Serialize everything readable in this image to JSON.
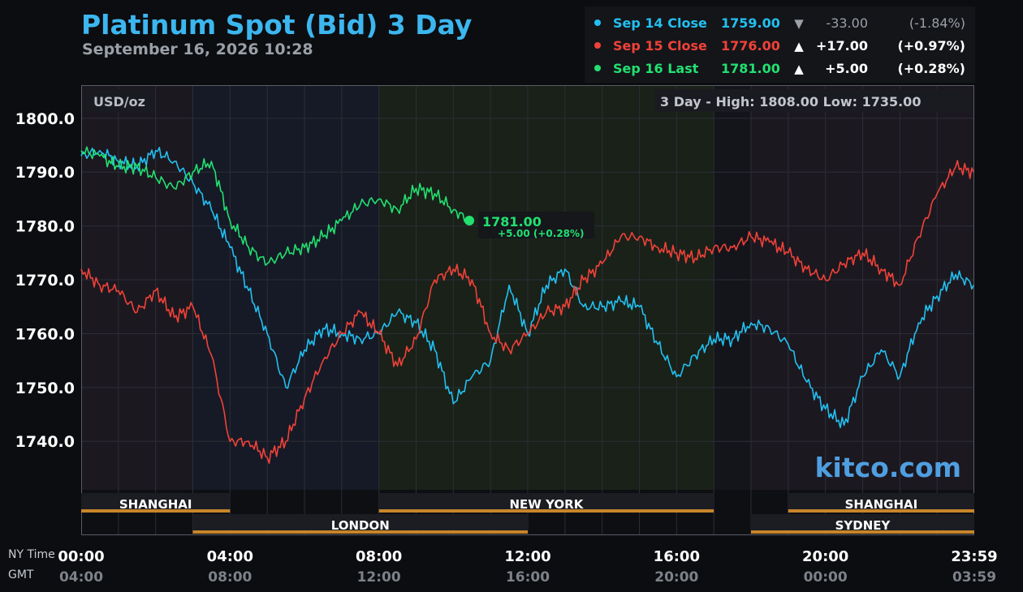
{
  "header": {
    "title": "Platinum Spot (Bid) 3 Day",
    "timestamp": "September 16, 2026 10:28"
  },
  "legend": [
    {
      "label": "Sep 14 Close",
      "price": "1759.00",
      "arrow": "▼",
      "change": "-33.00",
      "pct": "(-1.84%)",
      "color": "#22c0f0"
    },
    {
      "label": "Sep 15 Close",
      "price": "1776.00",
      "arrow": "▲",
      "change": "+17.00",
      "pct": "(+0.97%)",
      "color": "#f04238"
    },
    {
      "label": "Sep 16 Last",
      "price": "1781.00",
      "arrow": "▲",
      "change": "+5.00",
      "pct": "(+0.28%)",
      "color": "#22e070"
    }
  ],
  "chart": {
    "unit_label": "USD/oz",
    "range_label": "3 Day - High: 1808.00  Low: 1735.00",
    "watermark": "kitco.com",
    "last_price_label": "1781.00",
    "last_change_label": "+5.00 (+0.28%)",
    "ny_time_label": "NY Time",
    "gmt_label": "GMT",
    "grid": true
  },
  "sessions": [
    {
      "name": "SHANGHAI",
      "row": 1,
      "start": 0,
      "end": 4,
      "label_at": 2
    },
    {
      "name": "LONDON",
      "row": 2,
      "start": 3,
      "end": 12,
      "label_at": 7.5
    },
    {
      "name": "NEW YORK",
      "row": 1,
      "start": 8,
      "end": 17,
      "label_at": 12.5
    },
    {
      "name": "SHANGHAI",
      "row": 1,
      "start": 19,
      "end": 24,
      "label_at": 21.5
    },
    {
      "name": "SYDNEY",
      "row": 2,
      "start": 18,
      "end": 24,
      "label_at": 21
    }
  ],
  "chart_data": {
    "type": "line",
    "title": "Platinum Spot (Bid) 3 Day",
    "ylabel": "USD/oz",
    "ylim": [
      1731,
      1806
    ],
    "xlim": [
      0,
      24
    ],
    "yticks": [
      "1800.0",
      "1790.0",
      "1780.0",
      "1770.0",
      "1760.0",
      "1750.0",
      "1740.0"
    ],
    "ytick_values": [
      1800,
      1790,
      1780,
      1770,
      1760,
      1750,
      1740
    ],
    "xticks_ny": [
      "00:00",
      "04:00",
      "08:00",
      "12:00",
      "16:00",
      "20:00",
      "23:59"
    ],
    "xticks_gmt": [
      "04:00",
      "08:00",
      "12:00",
      "16:00",
      "20:00",
      "00:00",
      "03:59"
    ],
    "xtick_hours": [
      0,
      4,
      8,
      12,
      16,
      20,
      24
    ],
    "series": [
      {
        "name": "Sep 14 Close",
        "color": "#22c0f0",
        "x": [
          0,
          0.5,
          1,
          1.5,
          2,
          2.5,
          3,
          3.5,
          4,
          4.5,
          5,
          5.5,
          6,
          6.5,
          7,
          7.5,
          8,
          8.5,
          9,
          9.5,
          10,
          10.5,
          11,
          11.5,
          12,
          12.5,
          13,
          13.5,
          14,
          14.5,
          15,
          15.5,
          16,
          16.5,
          17,
          17.5,
          18,
          18.5,
          19,
          19.5,
          20,
          20.5,
          21,
          21.5,
          22,
          22.5,
          23,
          23.5,
          23.98
        ],
        "y": [
          1793,
          1794,
          1792,
          1791,
          1794,
          1792,
          1788,
          1783,
          1776,
          1768,
          1760,
          1750,
          1757,
          1761,
          1760,
          1759,
          1760,
          1764,
          1762,
          1757,
          1747,
          1752,
          1755,
          1769,
          1760,
          1769,
          1772,
          1765,
          1765,
          1766,
          1765,
          1758,
          1752,
          1756,
          1759,
          1759,
          1762,
          1761,
          1758,
          1751,
          1746,
          1743,
          1752,
          1757,
          1752,
          1762,
          1767,
          1771,
          1769
        ]
      },
      {
        "name": "Sep 15 Close",
        "color": "#f04238",
        "x": [
          0,
          0.5,
          1,
          1.5,
          2,
          2.5,
          3,
          3.5,
          4,
          4.5,
          5,
          5.5,
          6,
          6.5,
          7,
          7.5,
          8,
          8.5,
          9,
          9.5,
          10,
          10.5,
          11,
          11.5,
          12,
          12.5,
          13,
          13.5,
          14,
          14.5,
          15,
          15.5,
          16,
          16.5,
          17,
          17.5,
          18,
          18.5,
          19,
          19.5,
          20,
          20.5,
          21,
          21.5,
          22,
          22.5,
          23,
          23.5,
          23.98
        ],
        "y": [
          1772,
          1769,
          1768,
          1764,
          1768,
          1763,
          1765,
          1756,
          1740,
          1740,
          1737,
          1740,
          1748,
          1755,
          1760,
          1764,
          1760,
          1754,
          1759,
          1770,
          1772,
          1770,
          1760,
          1757,
          1760,
          1764,
          1765,
          1770,
          1773,
          1778,
          1778,
          1776,
          1775,
          1774,
          1776,
          1776,
          1778,
          1777,
          1775,
          1772,
          1770,
          1773,
          1775,
          1772,
          1769,
          1778,
          1786,
          1791,
          1790
        ]
      },
      {
        "name": "Sep 16 Last",
        "color": "#22e070",
        "x": [
          0,
          0.5,
          1,
          1.5,
          2,
          2.5,
          3,
          3.5,
          4,
          4.5,
          5,
          5.5,
          6,
          6.5,
          7,
          7.5,
          8,
          8.5,
          9,
          9.5,
          10,
          10.43
        ],
        "y": [
          1794,
          1793,
          1791,
          1791,
          1789,
          1787,
          1790,
          1792,
          1781,
          1776,
          1773,
          1775,
          1776,
          1778,
          1781,
          1784,
          1785,
          1783,
          1787,
          1786,
          1783,
          1781
        ]
      }
    ]
  }
}
